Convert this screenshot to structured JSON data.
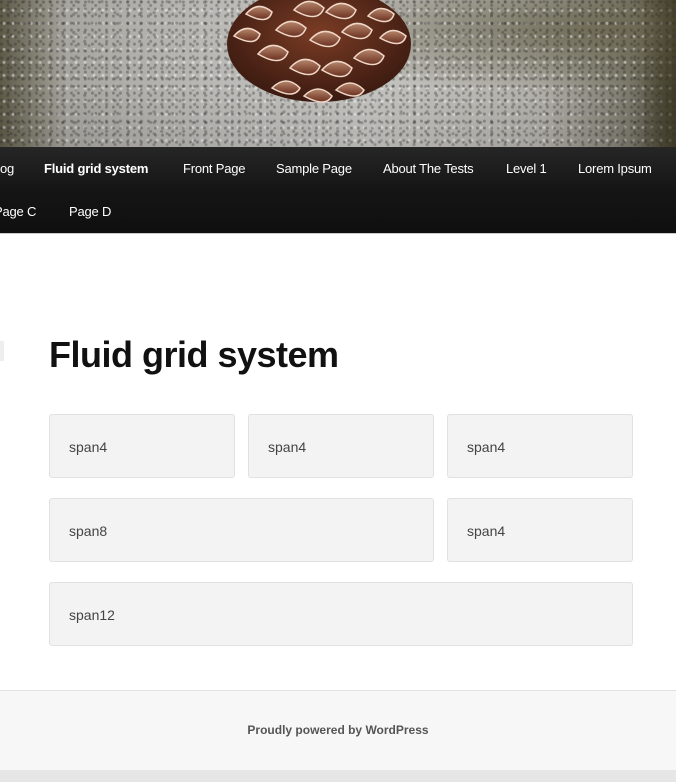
{
  "nav": {
    "items": [
      {
        "label": "og",
        "active": false
      },
      {
        "label": "Fluid grid system",
        "active": true
      },
      {
        "label": "Front Page",
        "active": false
      },
      {
        "label": "Sample Page",
        "active": false
      },
      {
        "label": "About The Tests",
        "active": false
      },
      {
        "label": "Level 1",
        "active": false
      },
      {
        "label": "Lorem Ipsum",
        "active": false
      },
      {
        "label": "Page C",
        "active": false
      },
      {
        "label": "Page D",
        "active": false
      }
    ]
  },
  "main": {
    "title": "Fluid grid system",
    "grid": [
      [
        "span4",
        "span4",
        "span4"
      ],
      [
        "span8",
        "span4"
      ],
      [
        "span12"
      ]
    ]
  },
  "footer": {
    "text": "Proudly powered by WordPress"
  },
  "colors": {
    "nav_bg": "#151515",
    "cell_bg": "#f3f3f3",
    "cell_border": "#e1e1e1",
    "title": "#111111",
    "footer_bg": "#f7f7f7"
  },
  "header_image": {
    "subject": "pinecone-on-granite-block"
  }
}
